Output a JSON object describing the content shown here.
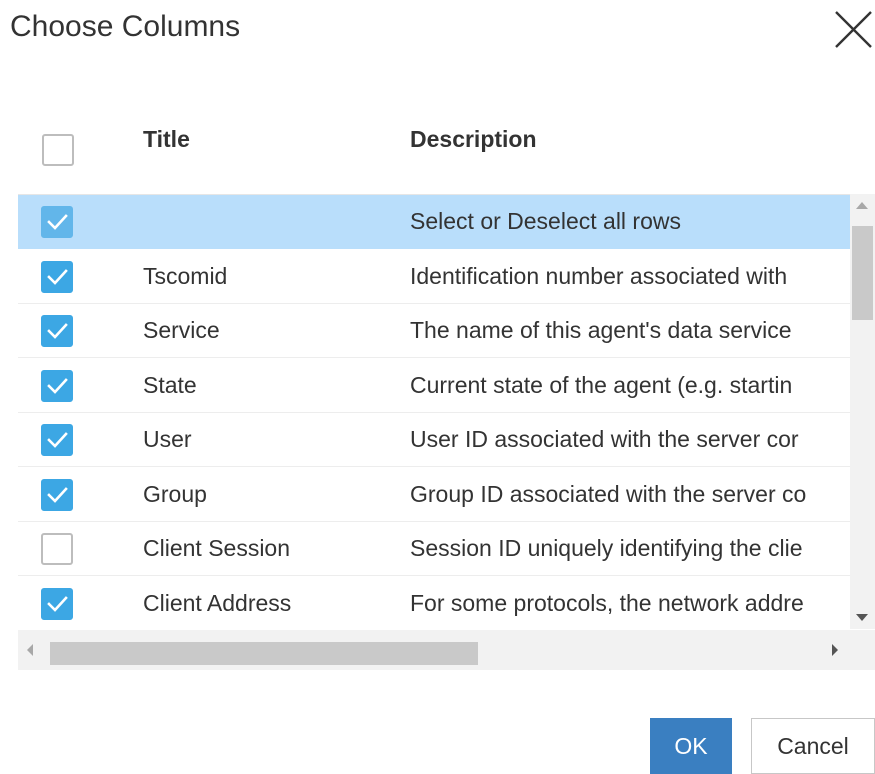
{
  "dialog": {
    "title": "Choose Columns",
    "close_icon": "close-icon"
  },
  "table": {
    "headers": {
      "select_all_checked": false,
      "title": "Title",
      "description": "Description"
    },
    "rows": [
      {
        "checked": true,
        "selected": true,
        "title": "",
        "description": "Select or Deselect all rows"
      },
      {
        "checked": true,
        "selected": false,
        "title": "Tscomid",
        "description": "Identification number associated with"
      },
      {
        "checked": true,
        "selected": false,
        "title": "Service",
        "description": "The name of this agent's data service"
      },
      {
        "checked": true,
        "selected": false,
        "title": "State",
        "description": "Current state of the agent (e.g. startin"
      },
      {
        "checked": true,
        "selected": false,
        "title": "User",
        "description": "User ID associated with the server cor"
      },
      {
        "checked": true,
        "selected": false,
        "title": "Group",
        "description": "Group ID associated with the server co"
      },
      {
        "checked": false,
        "selected": false,
        "title": "Client Session",
        "description": "Session ID uniquely identifying the clie"
      },
      {
        "checked": true,
        "selected": false,
        "title": "Client Address",
        "description": "For some protocols, the network addre"
      }
    ]
  },
  "buttons": {
    "ok": "OK",
    "cancel": "Cancel"
  },
  "colors": {
    "accent": "#3ca7e4",
    "selected_row": "#b9defb",
    "ok_button": "#3a7fc1"
  }
}
